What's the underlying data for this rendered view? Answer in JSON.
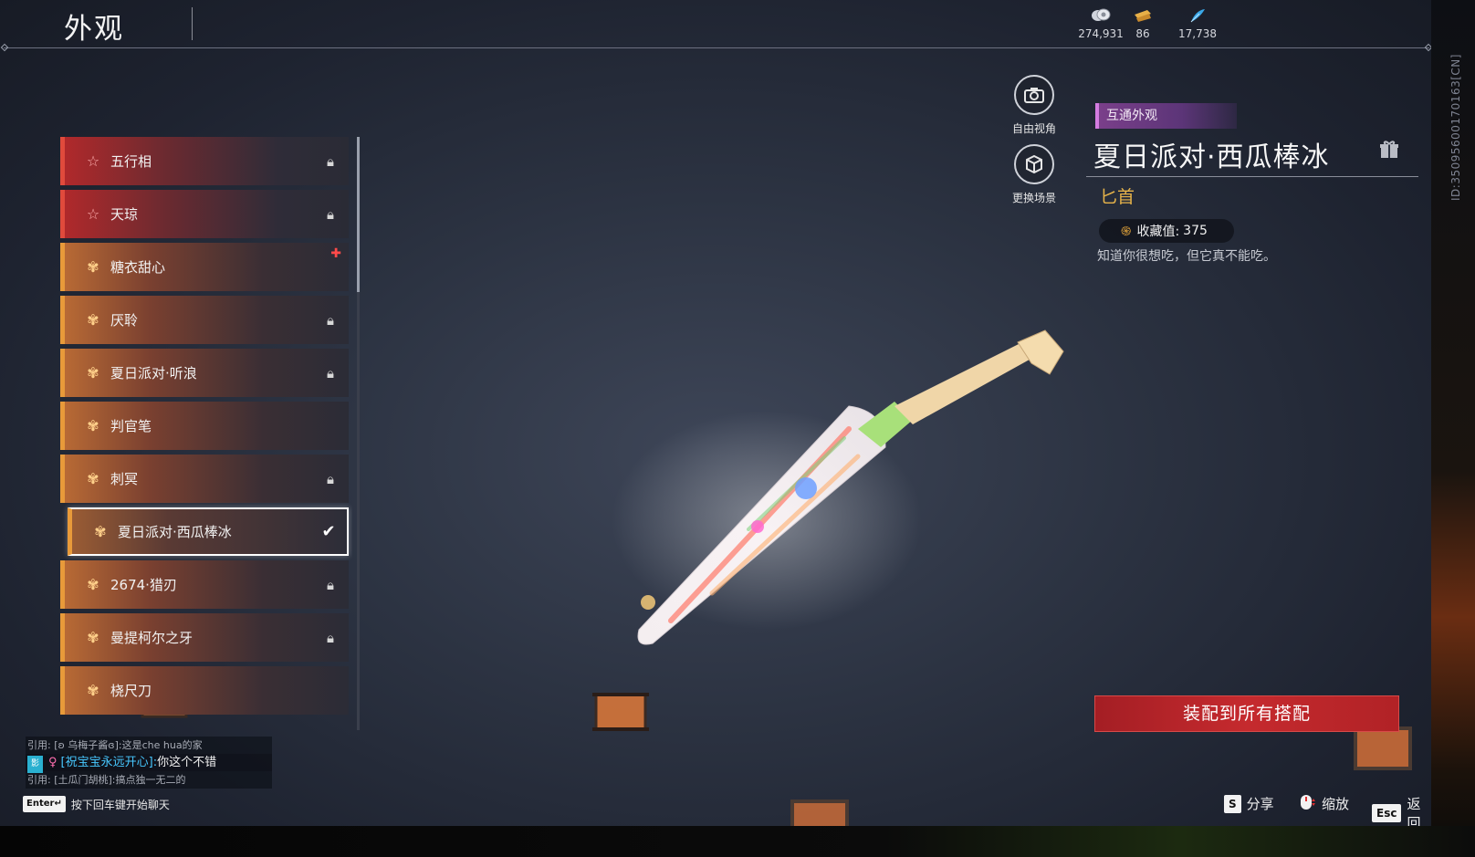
{
  "page_title": "外观",
  "currencies": [
    {
      "icon": "coin-icon",
      "value": "274,931"
    },
    {
      "icon": "ticket-icon",
      "value": "86"
    },
    {
      "icon": "feather-icon",
      "value": "17,738"
    }
  ],
  "side_id": "ID:3509560017016​3[CN]",
  "skins": [
    {
      "name": "五行相",
      "rarity": "red",
      "status": "locked"
    },
    {
      "name": "天琼",
      "rarity": "red",
      "status": "locked"
    },
    {
      "name": "糖衣甜心",
      "rarity": "orange",
      "status": "new"
    },
    {
      "name": "厌聆",
      "rarity": "orange",
      "status": "locked"
    },
    {
      "name": "夏日派对·听浪",
      "rarity": "orange",
      "status": "locked"
    },
    {
      "name": "判官笔",
      "rarity": "orange",
      "status": "none"
    },
    {
      "name": "刺冥",
      "rarity": "orange",
      "status": "locked"
    },
    {
      "name": "夏日派对·西瓜棒冰",
      "rarity": "orange",
      "status": "equipped"
    },
    {
      "name": "2674·猎刃",
      "rarity": "orange",
      "status": "locked"
    },
    {
      "name": "曼提柯尔之牙",
      "rarity": "orange",
      "status": "locked"
    },
    {
      "name": "桡尺刀",
      "rarity": "orange",
      "status": "none"
    }
  ],
  "scene_buttons": {
    "free_view": "自由视角",
    "change_scene": "更换场景"
  },
  "detail": {
    "tag": "互通外观",
    "title": "夏日派对·西瓜棒冰",
    "type": "匕首",
    "collect_label": "收藏值:",
    "collect_value": "375",
    "description": "知道你很想吃，但它真不能吃。"
  },
  "equip_all_label": "装配到所有搭配",
  "hints": {
    "share_key": "S",
    "share_label": "分享",
    "zoom_label": "缩放",
    "back_key": "Esc",
    "back_label": "返回"
  },
  "chat": {
    "lines": [
      {
        "type": "quote",
        "text": "引用: [ʚ 乌梅子酱ɞ]:这是che hua的家"
      },
      {
        "type": "message",
        "badge": "影",
        "user": "[祝宝宝永远开心]:",
        "text": "你这个不错"
      },
      {
        "type": "quote",
        "text": "引用: [土瓜门胡桃]:搞点独一无二的"
      }
    ],
    "enter_key": "Enter↵",
    "enter_hint": "按下回车键开始聊天"
  },
  "colors": {
    "red_rarity": "#e04a3c",
    "orange_rarity": "#e89a3a",
    "equip_button": "#c52a2e",
    "weapon_type": "#e6b34a",
    "shared_tag": "#7a3f8a"
  }
}
